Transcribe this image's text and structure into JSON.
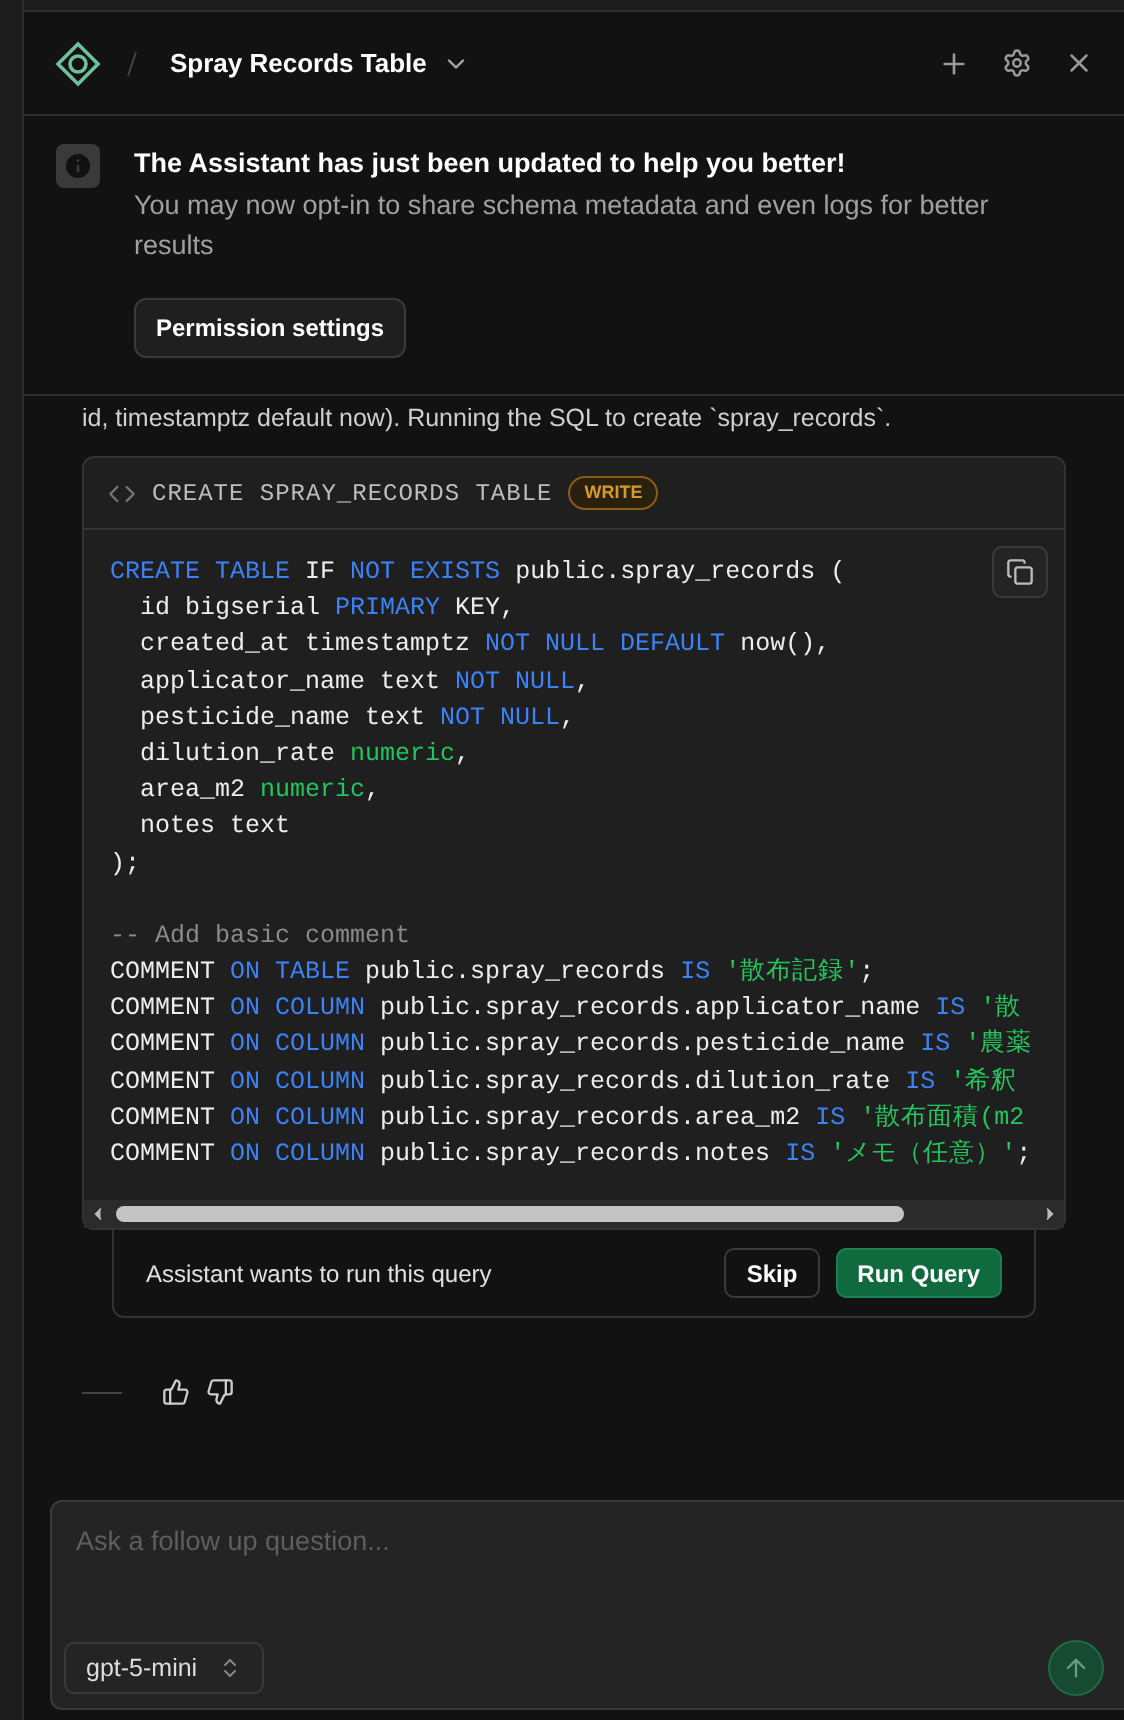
{
  "header": {
    "title": "Spray Records Table"
  },
  "banner": {
    "title": "The Assistant has just been updated to help you better!",
    "body": "You may now opt-in to share schema metadata and even logs for better results",
    "button": "Permission settings"
  },
  "message": {
    "text": "id, timestamptz default now). Running the SQL to create `spray_records`."
  },
  "code_block": {
    "title": "CREATE SPRAY_RECORDS TABLE",
    "badge": "WRITE",
    "lines": [
      [
        {
          "kind": "keyword",
          "text": "CREATE TABLE "
        },
        {
          "kind": "plain",
          "text": "IF "
        },
        {
          "kind": "keyword",
          "text": "NOT EXISTS "
        },
        {
          "kind": "plain",
          "text": "public.spray_records ("
        }
      ],
      [
        {
          "kind": "plain",
          "text": "  id bigserial "
        },
        {
          "kind": "keyword",
          "text": "PRIMARY "
        },
        {
          "kind": "plain",
          "text": "KEY,"
        }
      ],
      [
        {
          "kind": "plain",
          "text": "  created_at timestamptz "
        },
        {
          "kind": "keyword",
          "text": "NOT NULL DEFAULT "
        },
        {
          "kind": "plain",
          "text": "now(),"
        }
      ],
      [
        {
          "kind": "plain",
          "text": "  applicator_name text "
        },
        {
          "kind": "keyword",
          "text": "NOT NULL"
        },
        {
          "kind": "plain",
          "text": ","
        }
      ],
      [
        {
          "kind": "plain",
          "text": "  pesticide_name text "
        },
        {
          "kind": "keyword",
          "text": "NOT NULL"
        },
        {
          "kind": "plain",
          "text": ","
        }
      ],
      [
        {
          "kind": "plain",
          "text": "  dilution_rate "
        },
        {
          "kind": "type",
          "text": "numeric"
        },
        {
          "kind": "plain",
          "text": ","
        }
      ],
      [
        {
          "kind": "plain",
          "text": "  area_m2 "
        },
        {
          "kind": "type",
          "text": "numeric"
        },
        {
          "kind": "plain",
          "text": ","
        }
      ],
      [
        {
          "kind": "plain",
          "text": "  notes text"
        }
      ],
      [
        {
          "kind": "plain",
          "text": ");"
        }
      ],
      [
        {
          "kind": "blank"
        }
      ],
      [
        {
          "kind": "comment",
          "text": "-- Add basic comment"
        }
      ],
      [
        {
          "kind": "plain",
          "text": "COMMENT "
        },
        {
          "kind": "keyword",
          "text": "ON TABLE "
        },
        {
          "kind": "plain",
          "text": "public.spray_records "
        },
        {
          "kind": "keyword",
          "text": "IS "
        },
        {
          "kind": "string",
          "text": "'散布記録'"
        },
        {
          "kind": "plain",
          "text": ";"
        }
      ],
      [
        {
          "kind": "plain",
          "text": "COMMENT "
        },
        {
          "kind": "keyword",
          "text": "ON COLUMN "
        },
        {
          "kind": "plain",
          "text": "public.spray_records.applicator_name "
        },
        {
          "kind": "keyword",
          "text": "IS "
        },
        {
          "kind": "string",
          "text": "'散"
        }
      ],
      [
        {
          "kind": "plain",
          "text": "COMMENT "
        },
        {
          "kind": "keyword",
          "text": "ON COLUMN "
        },
        {
          "kind": "plain",
          "text": "public.spray_records.pesticide_name "
        },
        {
          "kind": "keyword",
          "text": "IS "
        },
        {
          "kind": "string",
          "text": "'農薬"
        }
      ],
      [
        {
          "kind": "plain",
          "text": "COMMENT "
        },
        {
          "kind": "keyword",
          "text": "ON COLUMN "
        },
        {
          "kind": "plain",
          "text": "public.spray_records.dilution_rate "
        },
        {
          "kind": "keyword",
          "text": "IS "
        },
        {
          "kind": "string",
          "text": "'希釈"
        }
      ],
      [
        {
          "kind": "plain",
          "text": "COMMENT "
        },
        {
          "kind": "keyword",
          "text": "ON COLUMN "
        },
        {
          "kind": "plain",
          "text": "public.spray_records.area_m2 "
        },
        {
          "kind": "keyword",
          "text": "IS "
        },
        {
          "kind": "string",
          "text": "'散布面積(m2"
        }
      ],
      [
        {
          "kind": "plain",
          "text": "COMMENT "
        },
        {
          "kind": "keyword",
          "text": "ON COLUMN "
        },
        {
          "kind": "plain",
          "text": "public.spray_records.notes "
        },
        {
          "kind": "keyword",
          "text": "IS "
        },
        {
          "kind": "string",
          "text": "'メモ（任意）'"
        },
        {
          "kind": "plain",
          "text": ";"
        }
      ]
    ]
  },
  "approval": {
    "text": "Assistant wants to run this query",
    "buttons": [
      "Skip",
      "Run Query"
    ]
  },
  "composer": {
    "placeholder": "Ask a follow up question...",
    "model": "gpt-5-mini"
  }
}
